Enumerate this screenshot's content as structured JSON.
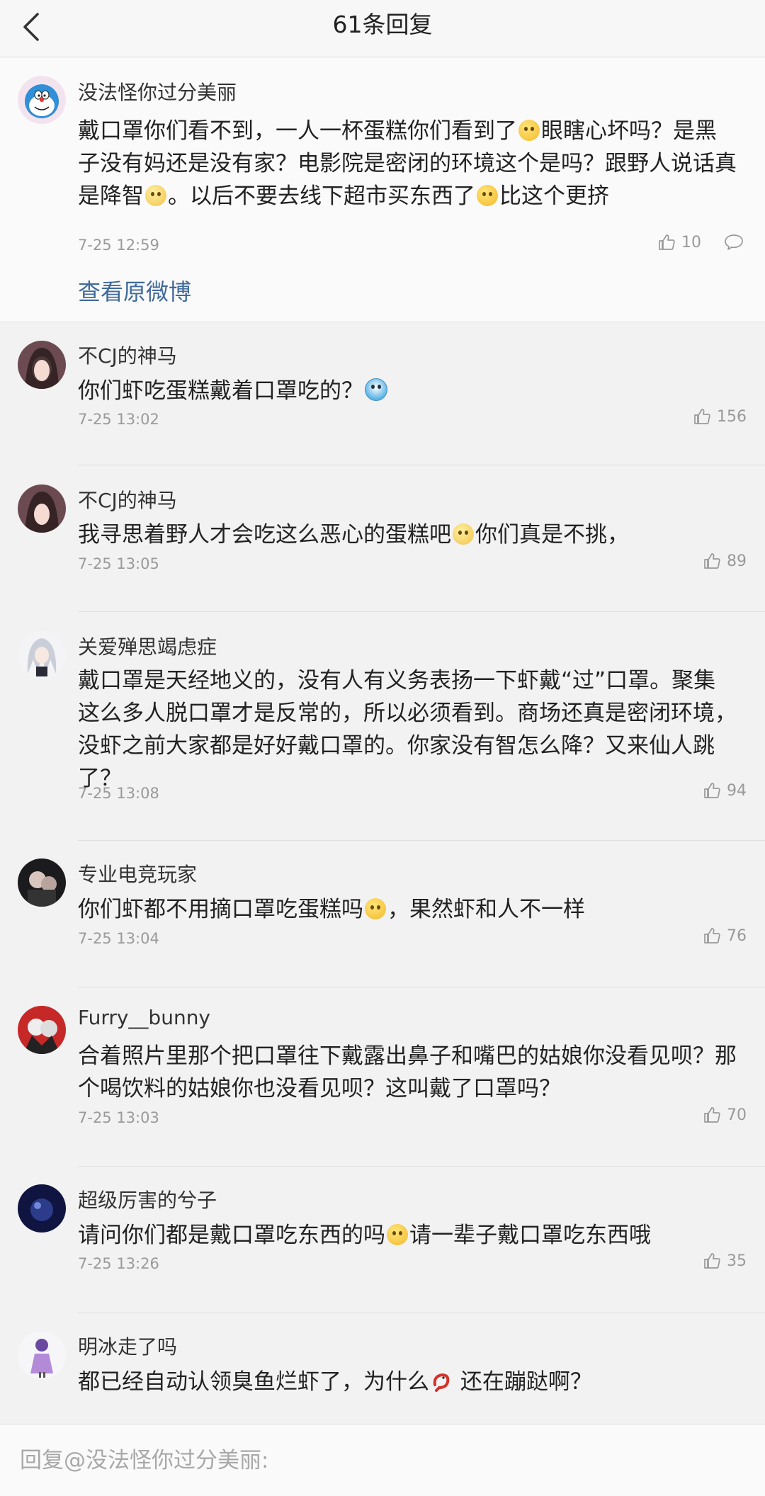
{
  "header": {
    "title": "61条回复"
  },
  "colors": {
    "link": "#406a9a",
    "meta": "#9a9a9a",
    "background": "#f2f2f2"
  },
  "original_comment": {
    "user": "没法怪你过分美丽",
    "avatar_icon": "doraemon-avatar",
    "text_parts": [
      "戴口罩你们看不到，一人一杯蛋糕你们看到了",
      "眼瞎心坏吗？是黑子没有妈还是没有家？电影院是密闭的环境这个是吗？跟野人说话真是降智",
      "。以后不要去线下超市买东西了",
      "比这个更挤"
    ],
    "time": "7-25 12:59",
    "likes": "10",
    "view_original": "查看原微博"
  },
  "replies": [
    {
      "user": "不CJ的神马",
      "text_parts": [
        "你们虾吃蛋糕戴着口罩吃的？"
      ],
      "time": "7-25 13:02",
      "likes": "156"
    },
    {
      "user": "不CJ的神马",
      "text_parts": [
        "我寻思着野人才会吃这么恶心的蛋糕吧",
        "你们真是不挑，"
      ],
      "time": "7-25 13:05",
      "likes": "89"
    },
    {
      "user": "关爱殚思竭虑症",
      "text_parts": [
        "戴口罩是天经地义的，没有人有义务表扬一下虾戴“过”口罩。聚集这么多人脱口罩才是反常的，所以必须看到。商场还真是密闭环境，没虾之前大家都是好好戴口罩的。你家没有智怎么降？又来仙人跳了？"
      ],
      "time": "7-25 13:08",
      "likes": "94"
    },
    {
      "user": "专业电竞玩家",
      "text_parts": [
        "你们虾都不用摘口罩吃蛋糕吗",
        "，果然虾和人不一样"
      ],
      "time": "7-25 13:04",
      "likes": "76"
    },
    {
      "user": "Furry__bunny",
      "text_parts": [
        "合着照片里那个把口罩往下戴露出鼻子和嘴巴的姑娘你没看见呗？那个喝饮料的姑娘你也没看见呗？这叫戴了口罩吗？"
      ],
      "time": "7-25 13:03",
      "likes": "70"
    },
    {
      "user": "超级厉害的兮子",
      "text_parts": [
        "请问你们都是戴口罩吃东西的吗",
        "请一辈子戴口罩吃东西哦"
      ],
      "time": "7-25 13:26",
      "likes": "35"
    },
    {
      "user": "明冰走了吗",
      "text_parts": [
        "都已经自动认领臭鱼烂虾了，为什么",
        " 还在蹦跶啊？"
      ],
      "time": "",
      "likes": ""
    }
  ],
  "input": {
    "placeholder": "回复@没法怪你过分美丽:"
  }
}
